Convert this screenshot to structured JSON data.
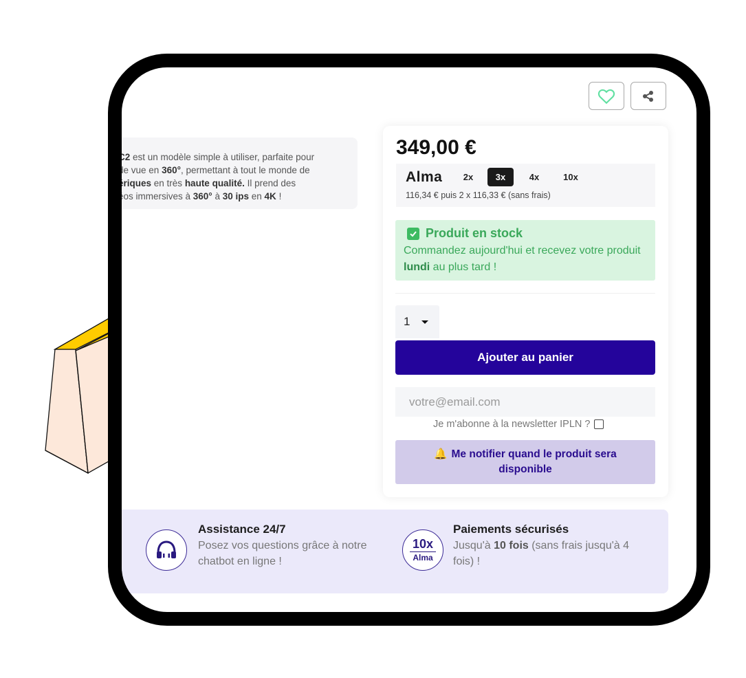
{
  "header": {
    "wishlist_icon": "heart-icon",
    "share_icon": "share-icon"
  },
  "description": {
    "line1_b": "C2",
    "line1": " est un modèle simple à utiliser, parfaite pour",
    "line2a": "de vue en ",
    "line2_b": "360°",
    "line2b": ", permettant à tout le monde de",
    "line3_b1": "ériques",
    "line3a": " en très ",
    "line3_b2": "haute qualité.",
    "line3b": " Il prend des",
    "line4a": "éos immersives à ",
    "line4_b1": "360°",
    "line4b": " à ",
    "line4_b2": "30 ips",
    "line4c": " en ",
    "line4_b3": "4K",
    "line4d": " !"
  },
  "product": {
    "price": "349,00 €"
  },
  "alma": {
    "logo": "Alma",
    "options": [
      "2x",
      "3x",
      "4x",
      "10x"
    ],
    "selected": "3x",
    "note": "116,34 € puis 2 x 116,33 € (sans frais)"
  },
  "stock": {
    "title": "Produit en stock",
    "desc_a": "Commandez aujourd'hui et recevez votre produit ",
    "desc_b": "lundi",
    "desc_c": " au plus tard !"
  },
  "quantity": {
    "value": "1"
  },
  "cart": {
    "add_label": "Ajouter au panier"
  },
  "notify": {
    "email_placeholder": "votre@email.com",
    "newsletter_label": "Je m'abonne à la newsletter IPLN ?",
    "newsletter_checked": false,
    "button_label": "Me notifier quand le produit sera disponible",
    "bell_icon": "bell-icon"
  },
  "features": [
    {
      "icon": "headphones-icon",
      "title": "Assistance 24/7",
      "desc_a": "Posez vos questions grâce à notre chatbot en ligne !"
    },
    {
      "icon_top": "10x",
      "icon_bottom": "Alma",
      "title": "Paiements sécurisés",
      "desc_a": "Jusqu'à ",
      "desc_b": "10 fois",
      "desc_c": " (sans frais jusqu'à 4 fois) !"
    }
  ],
  "colors": {
    "primary": "#24049b",
    "stock_bg": "#d9f4e0",
    "stock_text": "#3aa85a",
    "notify_bg": "#d2cbea",
    "band_bg": "#ebe9fa",
    "frame": "#000000",
    "bag_body": "#fde8da",
    "bag_accent": "#ffcc00"
  }
}
